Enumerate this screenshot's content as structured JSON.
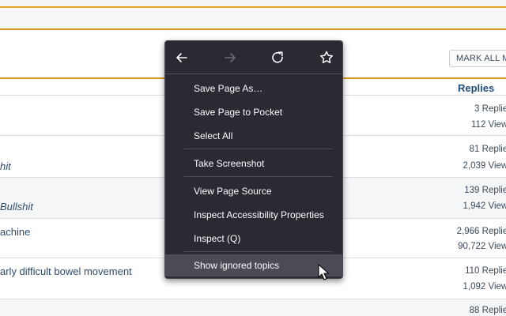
{
  "toolbar": {
    "mark_all_label": "MARK ALL M"
  },
  "table": {
    "header_replies": "Replies",
    "rows": [
      {
        "title": "",
        "italic": false,
        "replies": "3 Replies",
        "views": "112 Views"
      },
      {
        "title": "hit",
        "italic": true,
        "replies": "81 Replies",
        "views": "2,039 Views"
      },
      {
        "title": "Bullshit",
        "italic": true,
        "replies": "139 Replies",
        "views": "1,942 Views"
      },
      {
        "title": "achine",
        "italic": false,
        "replies": "2,966 Replies",
        "views": "90,722 Views"
      },
      {
        "title": "arly difficult bowel movement",
        "italic": false,
        "replies": "110 Replies",
        "views": "1,092 Views"
      },
      {
        "title": "",
        "italic": false,
        "replies": "88 Replies",
        "views": ""
      }
    ]
  },
  "context_menu": {
    "nav": [
      {
        "icon": "back-arrow-icon",
        "enabled": true
      },
      {
        "icon": "forward-arrow-icon",
        "enabled": false
      },
      {
        "icon": "reload-icon",
        "enabled": true
      },
      {
        "icon": "bookmark-star-icon",
        "enabled": true
      }
    ],
    "items": [
      {
        "label": "Save Page As…"
      },
      {
        "label": "Save Page to Pocket"
      },
      {
        "label": "Select All"
      },
      {
        "label": "Take Screenshot"
      },
      {
        "label": "View Page Source"
      },
      {
        "label": "Inspect Accessibility Properties"
      },
      {
        "label": "Inspect (Q)"
      },
      {
        "label": "Show ignored topics",
        "hovered": true
      }
    ]
  },
  "colors": {
    "accent_gold": "#d99a1d",
    "menu_background": "#2b2a33",
    "menu_hover": "#4c4b55",
    "link_blue": "#2e4a6d"
  }
}
